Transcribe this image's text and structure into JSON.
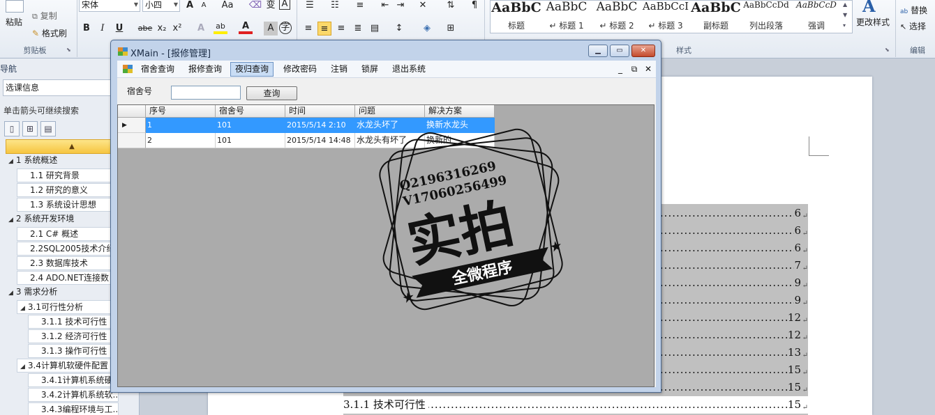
{
  "ribbon": {
    "clipboard": {
      "paste": "粘贴",
      "copy": "复制",
      "format_painter": "格式刷",
      "group_label": "剪贴板"
    },
    "font": {
      "name": "宋体",
      "size": "小四",
      "case_btn": "Aa",
      "bold": "B",
      "italic": "I",
      "underline": "U",
      "strike": "abe",
      "subscript": "x₂",
      "superscript": "x²"
    },
    "styles": {
      "group_label": "样式",
      "items": [
        {
          "preview": "AaBbC",
          "label": "标题"
        },
        {
          "preview": "AaBbC",
          "label": "↵ 标题 1"
        },
        {
          "preview": "AaBbC",
          "label": "↵ 标题 2"
        },
        {
          "preview": "AaBbCcI",
          "label": "↵ 标题 3"
        },
        {
          "preview": "AaBbC",
          "label": "副标题"
        },
        {
          "preview": "AaBbCcDd",
          "label": "列出段落"
        },
        {
          "preview": "AaBbCcD",
          "label": "强调"
        }
      ],
      "change_styles": "更改样式"
    },
    "editing": {
      "group_label": "编辑",
      "replace": "替换",
      "select": "选择"
    }
  },
  "nav": {
    "title": "导航",
    "search_value": "选课信息",
    "hint": "单击箭头可继续搜索",
    "tree": [
      {
        "label": "1 系统概述",
        "level": 1
      },
      {
        "label": "1.1 研究背景",
        "level": 2
      },
      {
        "label": "1.2 研究的意义",
        "level": 2
      },
      {
        "label": "1.3 系统设计思想",
        "level": 2
      },
      {
        "label": "2 系统开发环境",
        "level": 1
      },
      {
        "label": "2.1 C# 概述",
        "level": 2
      },
      {
        "label": "2.2SQL2005技术介绍",
        "level": 2
      },
      {
        "label": "2.3 数据库技术",
        "level": 2
      },
      {
        "label": "2.4  ADO.NET连接数",
        "level": 2
      },
      {
        "label": "3 需求分析",
        "level": 1
      },
      {
        "label": "3.1可行性分析",
        "level": 2
      },
      {
        "label": "3.1.1 技术可行性",
        "level": 3
      },
      {
        "label": "3.1.2 经济可行性",
        "level": 3
      },
      {
        "label": "3.1.3 操作可行性",
        "level": 3
      },
      {
        "label": "3.4计算机软硬件配置",
        "level": 2
      },
      {
        "label": "3.4.1计算机系统硬",
        "level": 3
      },
      {
        "label": "3.4.2计算机系统软...",
        "level": 3
      },
      {
        "label": "3.4.3编程环境与工...",
        "level": 3
      }
    ]
  },
  "document": {
    "toc_pages": [
      "6",
      "6",
      "6",
      "7",
      "9",
      "9",
      "12",
      "12",
      "13",
      "15",
      "15",
      "15"
    ],
    "last_entry_label": "3.1.1  技术可行性",
    "return_mark": "↵"
  },
  "window": {
    "title": "XMain - [报修管理]",
    "menu": [
      "宿舍查询",
      "报修查询",
      "夜归查询",
      "修改密码",
      "注销",
      "锁屏",
      "退出系统"
    ],
    "active_menu_index": 2,
    "search_label": "宿舍号",
    "search_value": "",
    "query_button": "查询",
    "grid": {
      "columns": [
        "序号",
        "宿舍号",
        "时间",
        "问题",
        "解决方案"
      ],
      "rows": [
        [
          "1",
          "101",
          "2015/5/14 2:10",
          "水龙头坏了",
          "换新水龙头"
        ],
        [
          "2",
          "101",
          "2015/5/14 14:48",
          "水龙头有坏了",
          "换新的"
        ]
      ],
      "selected_row": 0
    }
  },
  "watermark": {
    "qq": "Q2196316269",
    "wechat": "V17060256499",
    "main": "实拍",
    "banner": "全微程序"
  }
}
